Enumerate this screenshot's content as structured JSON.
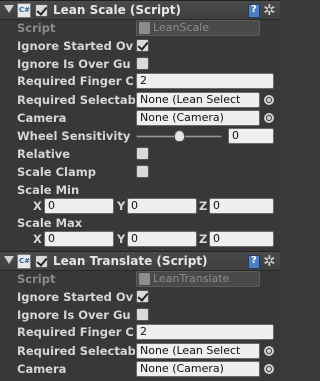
{
  "components": [
    {
      "title": "Lean Scale (Script)",
      "enabled": true,
      "script_label": "Script",
      "script_value": "LeanScale",
      "properties": {
        "ignore_started": {
          "label": "Ignore Started Ov",
          "checked": true
        },
        "ignore_over_gui": {
          "label": "Ignore Is Over Gu",
          "checked": false
        },
        "required_finger": {
          "label": "Required Finger C",
          "value": "2"
        },
        "required_selectable": {
          "label": "Required Selectab",
          "value": "None (Lean Select"
        },
        "camera": {
          "label": "Camera",
          "value": "None (Camera)"
        },
        "wheel_sensitivity": {
          "label": "Wheel Sensitivity",
          "value": "0",
          "slider_fraction": 0.5
        },
        "relative": {
          "label": "Relative",
          "checked": false
        },
        "scale_clamp": {
          "label": "Scale Clamp",
          "checked": false
        },
        "scale_min": {
          "label": "Scale Min",
          "x_label": "X",
          "y_label": "Y",
          "z_label": "Z",
          "x": "0",
          "y": "0",
          "z": "0"
        },
        "scale_max": {
          "label": "Scale Max",
          "x_label": "X",
          "y_label": "Y",
          "z_label": "Z",
          "x": "0",
          "y": "0",
          "z": "0"
        }
      }
    },
    {
      "title": "Lean Translate (Script)",
      "enabled": true,
      "script_label": "Script",
      "script_value": "LeanTranslate",
      "properties": {
        "ignore_started": {
          "label": "Ignore Started Ov",
          "checked": true
        },
        "ignore_over_gui": {
          "label": "Ignore Is Over Gu",
          "checked": false
        },
        "required_finger": {
          "label": "Required Finger C",
          "value": "2"
        },
        "required_selectable": {
          "label": "Required Selectab",
          "value": "None (Lean Select"
        },
        "camera": {
          "label": "Camera",
          "value": "None (Camera)"
        }
      }
    }
  ],
  "icons": {
    "foldout": "foldout-triangle-icon",
    "script": "csharp-script-icon",
    "help": "help-book-icon",
    "settings": "gear-icon",
    "object_picker": "object-picker-icon"
  }
}
